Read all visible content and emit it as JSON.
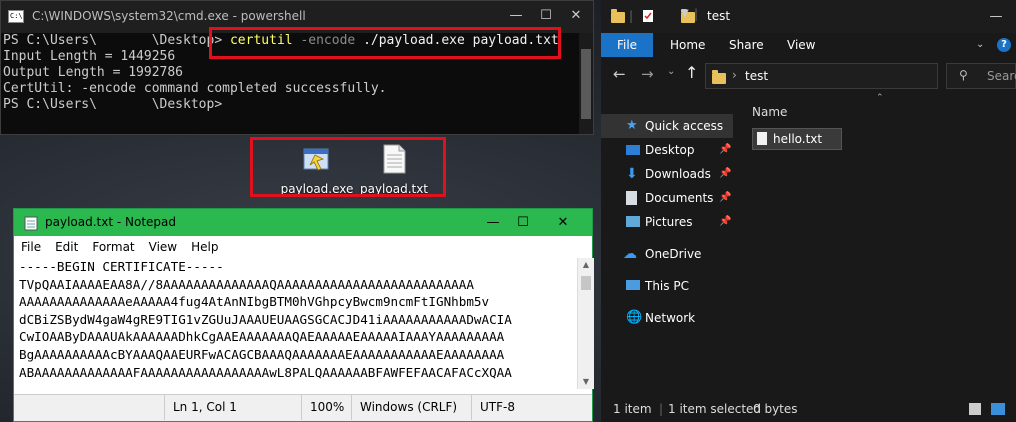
{
  "powershell": {
    "title": "C:\\WINDOWS\\system32\\cmd.exe - powershell",
    "prompt1": "PS C:\\Users\\       \\Desktop>",
    "cmd_name": "certutil",
    "cmd_flag": "-encode",
    "cmd_args": "./payload.exe payload.txt",
    "line2": "Input Length = 1449256",
    "line3": "Output Length = 1992786",
    "line4": "CertUtil: -encode command completed successfully.",
    "prompt2": "PS C:\\Users\\       \\Desktop>"
  },
  "desktop": {
    "icons": [
      {
        "label": "payload.exe",
        "icon": "application-icon"
      },
      {
        "label": "payload.txt",
        "icon": "text-file-icon"
      }
    ]
  },
  "notepad": {
    "title": "payload.txt - Notepad",
    "menu": [
      "File",
      "Edit",
      "Format",
      "View",
      "Help"
    ],
    "lines": [
      "-----BEGIN CERTIFICATE-----",
      "TVpQAAIAAAAEAA8A//8AAAAAAAAAAAAAAQAAAAAAAAAAAAAAAAAAAAAAAAAA",
      "AAAAAAAAAAAAAAeAAAAA4fug4AtAnNIbgBTM0hVGhpcyBwcm9ncmFtIGNhbm5v",
      "dCBiZSBydW4gaW4gRE9TIG1vZGUuJAAAUEUAAGSGCACJD41iAAAAAAAAAAADwACIA",
      "CwIOAAByDAAAUAkAAAAAADhkCgAAEAAAAAAAQAEAAAAAEAAAAAIAAAYAAAAAAAAA",
      "BgAAAAAAAAAAcBYAAAQAAEURFwACAGCBAAAQAAAAAAAEAAAAAAAAAAAEAAAAAAAA",
      "ABAAAAAAAAAAAAAFAAAAAAAAAAAAAAAAAwL8PALQAAAAAABFAWFEFAACAFACcXQAA"
    ],
    "status": {
      "position": "Ln 1, Col 1",
      "zoom": "100%",
      "eol": "Windows (CRLF)",
      "encoding": "UTF-8"
    }
  },
  "explorer": {
    "title": "test",
    "ribbon_tabs": [
      "File",
      "Home",
      "Share",
      "View"
    ],
    "path": "test",
    "search_placeholder": "Searc",
    "column_name": "Name",
    "nav": [
      {
        "label": "Quick access",
        "icon": "star-icon",
        "pinned": false,
        "selected": true
      },
      {
        "label": "Desktop",
        "icon": "desktop-icon",
        "pinned": true
      },
      {
        "label": "Downloads",
        "icon": "download-icon",
        "pinned": true
      },
      {
        "label": "Documents",
        "icon": "document-icon",
        "pinned": true
      },
      {
        "label": "Pictures",
        "icon": "picture-icon",
        "pinned": true
      },
      {
        "label": "OneDrive",
        "icon": "cloud-icon",
        "pinned": false
      },
      {
        "label": "This PC",
        "icon": "computer-icon",
        "pinned": false
      },
      {
        "label": "Network",
        "icon": "network-icon",
        "pinned": false
      }
    ],
    "files": [
      {
        "name": "hello.txt",
        "icon": "text-file-icon"
      }
    ],
    "status": {
      "count": "1 item",
      "selected": "1 item selected",
      "size": "0 bytes"
    }
  },
  "colors": {
    "highlight": "#e0101c",
    "notepad_titlebar": "#2ab84f",
    "explorer_accent": "#1a73c6"
  }
}
